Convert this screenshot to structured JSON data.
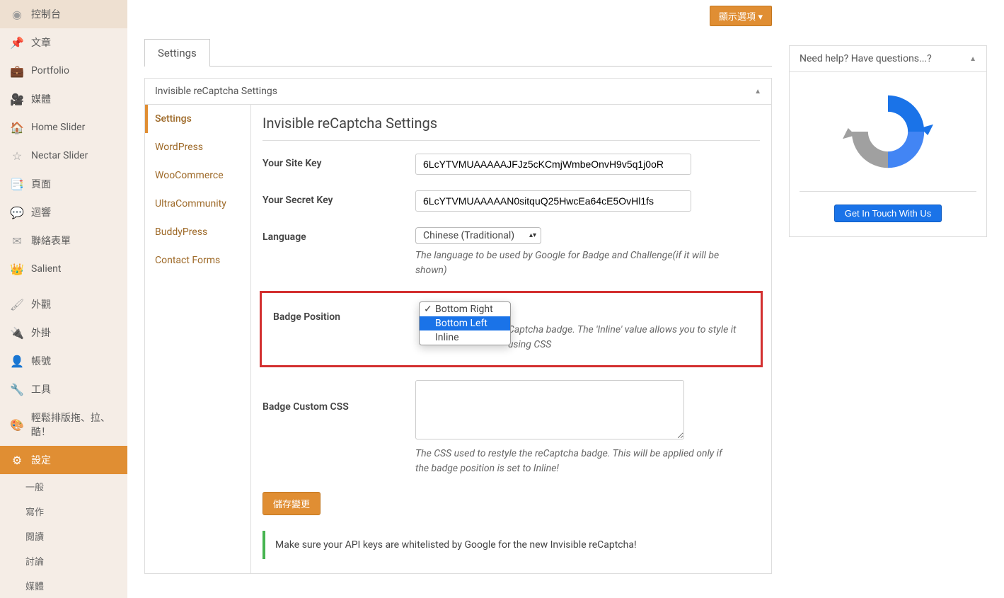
{
  "topButton": "顯示選項 ▾",
  "sidebar": {
    "items": [
      {
        "icon": "◉",
        "label": "控制台"
      },
      {
        "icon": "📌",
        "label": "文章"
      },
      {
        "icon": "💼",
        "label": "Portfolio"
      },
      {
        "icon": "🎥",
        "label": "媒體"
      },
      {
        "icon": "🏠",
        "label": "Home Slider"
      },
      {
        "icon": "☆",
        "label": "Nectar Slider"
      },
      {
        "icon": "📑",
        "label": "頁面"
      },
      {
        "icon": "💬",
        "label": "迴響"
      },
      {
        "icon": "✉",
        "label": "聯絡表單"
      },
      {
        "icon": "👑",
        "label": "Salient"
      },
      {
        "sep": true
      },
      {
        "icon": "🖌",
        "label": "外觀"
      },
      {
        "icon": "🔌",
        "label": "外掛"
      },
      {
        "icon": "👤",
        "label": "帳號"
      },
      {
        "icon": "🔧",
        "label": "工具"
      },
      {
        "icon": "🎨",
        "label": "輕鬆排版拖、拉、酷！"
      },
      {
        "icon": "⚙",
        "label": "設定",
        "active": true
      }
    ],
    "submenu": [
      "一般",
      "寫作",
      "閱讀",
      "討論",
      "媒體"
    ]
  },
  "tab": "Settings",
  "panel": {
    "title": "Invisible reCaptcha Settings",
    "innerNav": [
      "Settings",
      "WordPress",
      "WooCommerce",
      "UltraCommunity",
      "BuddyPress",
      "Contact Forms"
    ],
    "sectionTitle": "Invisible reCaptcha Settings",
    "siteKeyLabel": "Your Site Key",
    "siteKeyValue": "6LcYTVMUAAAAAJFJz5cKCmjWmbeOnvH9v5q1j0oR",
    "secretKeyLabel": "Your Secret Key",
    "secretKeyValue": "6LcYTVMUAAAAAN0sitquQ25HwcEa64cE5OvHl1fs",
    "langLabel": "Language",
    "langValue": "Chinese (Traditional)",
    "langDesc": "The language to be used by Google for Badge and Challenge(if it will be shown)",
    "badgeLabel": "Badge Position",
    "badgeDesc": "Captcha badge. The 'Inline' value allows you to style it using CSS",
    "badgeOptions": [
      "Bottom Right",
      "Bottom Left",
      "Inline"
    ],
    "cssLabel": "Badge Custom CSS",
    "cssDesc": "The CSS used to restyle the reCaptcha badge. This will be applied only if the badge position is set to Inline!",
    "saveBtn": "儲存變更",
    "notice": "Make sure your API keys are whitelisted by Google for the new Invisible reCaptcha!"
  },
  "help": {
    "title": "Need help? Have questions...?",
    "btn": "Get In Touch With Us"
  }
}
